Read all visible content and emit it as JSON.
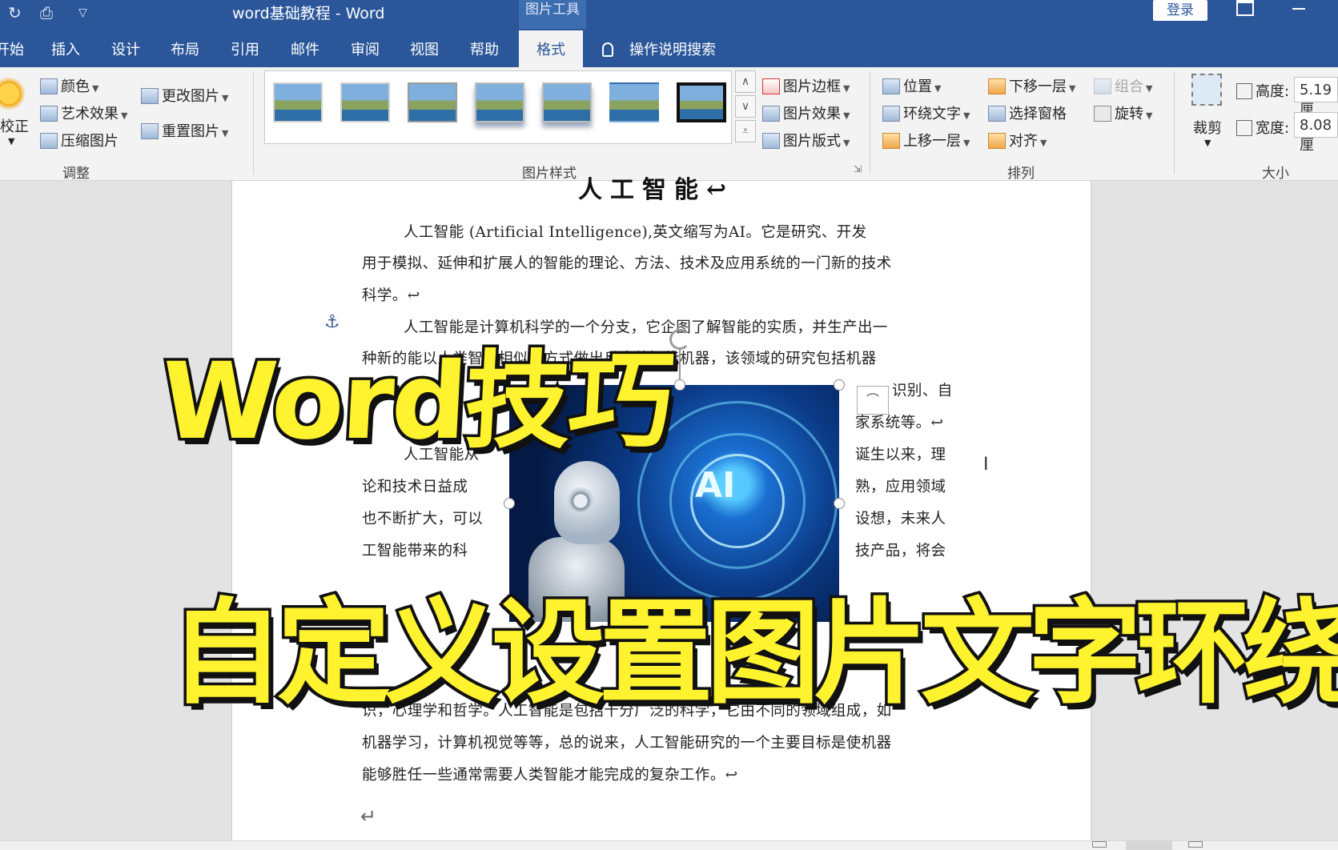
{
  "window": {
    "title": "word基础教程  -  Word",
    "context_tool": "图片工具",
    "login": "登录"
  },
  "tabs": [
    {
      "label": "开始"
    },
    {
      "label": "插入"
    },
    {
      "label": "设计"
    },
    {
      "label": "布局"
    },
    {
      "label": "引用"
    },
    {
      "label": "邮件"
    },
    {
      "label": "审阅"
    },
    {
      "label": "视图"
    },
    {
      "label": "帮助"
    },
    {
      "label": "格式",
      "active": true
    }
  ],
  "search_tab": "操作说明搜索",
  "ribbon": {
    "adjust": {
      "correct": "校正",
      "color": "颜色",
      "artistic": "艺术效果",
      "compress": "压缩图片",
      "change": "更改图片",
      "reset": "重置图片",
      "label": "调整"
    },
    "styles": {
      "border": "图片边框",
      "effects": "图片效果",
      "layout": "图片版式",
      "label": "图片样式"
    },
    "arrange": {
      "position": "位置",
      "wrap": "环绕文字",
      "bring_forward": "上移一层",
      "send_backward": "下移一层",
      "selection_pane": "选择窗格",
      "align": "对齐",
      "group": "组合",
      "rotate": "旋转",
      "label": "排列"
    },
    "size": {
      "crop": "裁剪",
      "height_label": "高度:",
      "height_value": "5.19 厘",
      "width_label": "宽度:",
      "width_value": "8.08 厘",
      "label": "大小"
    }
  },
  "document": {
    "heading": "人工智能↩",
    "lines": [
      "人工智能 (Artificial Intelligence),英文缩写为AI。它是研究、开发",
      "用于模拟、延伸和扩展人的智能的理论、方法、技术及应用系统的一门新的技术",
      "科学。↩",
      "人工智能是计算机科学的一个分支，它企图了解智能的实质，并生产出一",
      "种新的能以人类智能相似的方式做出反应的智能机器，该领域的研究包括机器",
      "识别、自",
      "家系统等。↩",
      "人工智能从",
      "诞生以来，理",
      "论和技术日益成",
      "熟，应用领域",
      "也不断扩大，可以",
      "设想，未来人",
      "工智能带来的科",
      "技产品，将会",
      "识，心理学和哲学。人工智能是包括十分广泛的科学，它由不同的领域组成，如",
      "机器学习，计算机视觉等等，总的说来，人工智能研究的一个主要目标是使机器",
      "能够胜任一些通常需要人类智能才能完成的复杂工作。↩"
    ],
    "picture_label": "AI",
    "return_mark": "↵"
  },
  "overlay": {
    "line1": "Word技巧",
    "line2": "自定义设置图片文字环绕方式"
  },
  "colors": {
    "accent": "#2b579a",
    "caption_fill": "#fff22e",
    "caption_stroke": "#111111"
  }
}
